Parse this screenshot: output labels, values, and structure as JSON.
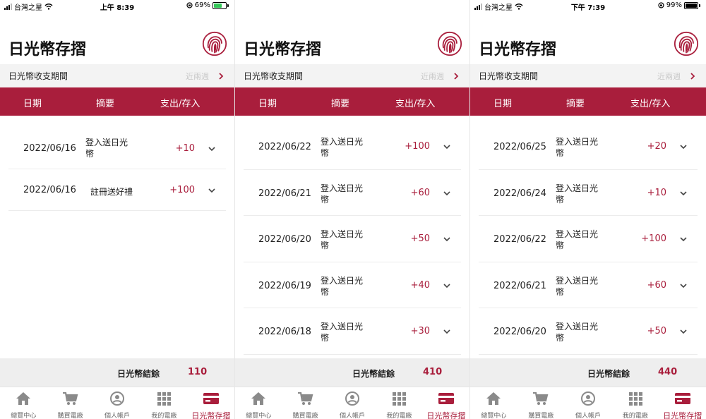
{
  "colors": {
    "primary": "#a91e3c",
    "muted": "#c8c8c8",
    "bar_bg": "#f3f3f3"
  },
  "screens": [
    {
      "status": {
        "carrier": "台灣之星",
        "time": "上午 8:39",
        "battery": "69%",
        "battery_level": 0.69,
        "charging": true
      },
      "title": "日光幣存摺",
      "period": {
        "label": "日光幣收支期間",
        "value": "近兩週"
      },
      "columns": [
        "日期",
        "摘要",
        "支出/存入"
      ],
      "rows": [
        {
          "date": "2022/06/16",
          "summary": "登入送日光幣",
          "amount": "+10"
        },
        {
          "date": "2022/06/16",
          "summary": "註冊送好禮",
          "amount": "+100"
        }
      ],
      "balance": {
        "label": "日光幣結餘",
        "value": "110"
      }
    },
    {
      "status": {
        "carrier": "",
        "time": "",
        "battery": "",
        "battery_level": 0,
        "charging": false
      },
      "title": "日光幣存摺",
      "period": {
        "label": "日光幣收支期間",
        "value": "近兩週"
      },
      "columns": [
        "日期",
        "摘要",
        "支出/存入"
      ],
      "rows": [
        {
          "date": "2022/06/22",
          "summary": "登入送日光幣",
          "amount": "+100"
        },
        {
          "date": "2022/06/21",
          "summary": "登入送日光幣",
          "amount": "+60"
        },
        {
          "date": "2022/06/20",
          "summary": "登入送日光幣",
          "amount": "+50"
        },
        {
          "date": "2022/06/19",
          "summary": "登入送日光幣",
          "amount": "+40"
        },
        {
          "date": "2022/06/18",
          "summary": "登入送日光幣",
          "amount": "+30"
        }
      ],
      "balance": {
        "label": "日光幣結餘",
        "value": "410"
      }
    },
    {
      "status": {
        "carrier": "台灣之星",
        "time": "下午 7:39",
        "battery": "99%",
        "battery_level": 0.99,
        "charging": false
      },
      "title": "日光幣存摺",
      "period": {
        "label": "日光幣收支期間",
        "value": "近兩週"
      },
      "columns": [
        "日期",
        "摘要",
        "支出/存入"
      ],
      "rows": [
        {
          "date": "2022/06/25",
          "summary": "登入送日光幣",
          "amount": "+20"
        },
        {
          "date": "2022/06/24",
          "summary": "登入送日光幣",
          "amount": "+10"
        },
        {
          "date": "2022/06/22",
          "summary": "登入送日光幣",
          "amount": "+100"
        },
        {
          "date": "2022/06/21",
          "summary": "登入送日光幣",
          "amount": "+60"
        },
        {
          "date": "2022/06/20",
          "summary": "登入送日光幣",
          "amount": "+50"
        }
      ],
      "balance": {
        "label": "日光幣結餘",
        "value": "440"
      }
    }
  ],
  "tabs": [
    {
      "label": "總覽中心",
      "icon": "home-icon",
      "active": false
    },
    {
      "label": "購買電廠",
      "icon": "cart-icon",
      "active": false
    },
    {
      "label": "個人帳戶",
      "icon": "user-icon",
      "active": false
    },
    {
      "label": "我的電廠",
      "icon": "grid-icon",
      "active": false
    },
    {
      "label": "日光幣存摺",
      "icon": "card-icon",
      "active": true
    }
  ]
}
